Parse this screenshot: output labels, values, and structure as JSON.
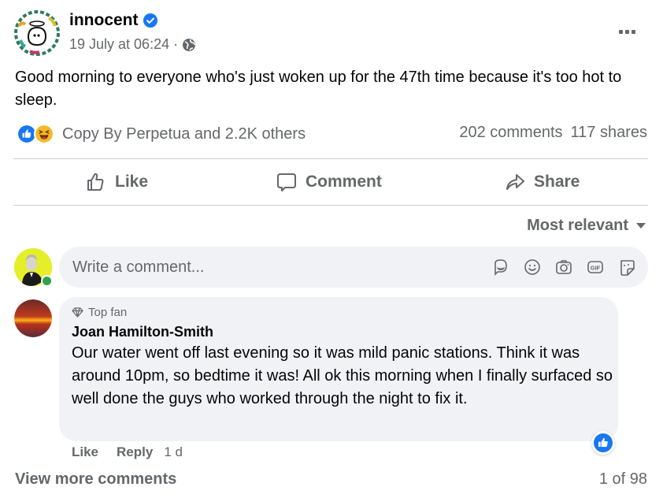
{
  "post": {
    "page_name": "innocent",
    "verified": true,
    "timestamp": "19 July at 06:24",
    "separator": "·",
    "audience_icon": "globe-icon",
    "text": "Good morning to everyone who's just woken up for the 47th time because it's too hot to sleep."
  },
  "reactions": {
    "icons": [
      "like-reaction-icon",
      "haha-reaction-icon"
    ],
    "summary": "Copy By Perpetua and 2.2K others",
    "comments": "202 comments",
    "shares": "117 shares"
  },
  "actions": {
    "like": "Like",
    "comment": "Comment",
    "share": "Share"
  },
  "comments_section": {
    "sort_label": "Most relevant",
    "composer_placeholder": "Write a comment...",
    "composer_icons": [
      "avatar-sticker-icon",
      "emoji-icon",
      "camera-icon",
      "gif-icon",
      "sticker-icon"
    ],
    "comments": [
      {
        "badge": "Top fan",
        "author": "Joan Hamilton-Smith",
        "text": "Our water went off last evening so it was mild panic stations. Think it was around 10pm, so bedtime it was! All ok this morning when I finally surfaced so well done the guys who worked through the night to fix it.",
        "like_label": "Like",
        "reply_label": "Reply",
        "age": "1 d",
        "reaction": "like"
      }
    ],
    "view_more": "View more comments",
    "pager": "1 of 98"
  },
  "colors": {
    "accent": "#1877f2",
    "secondary_text": "#65676b",
    "bubble": "#f0f2f5",
    "online": "#31a24c"
  }
}
